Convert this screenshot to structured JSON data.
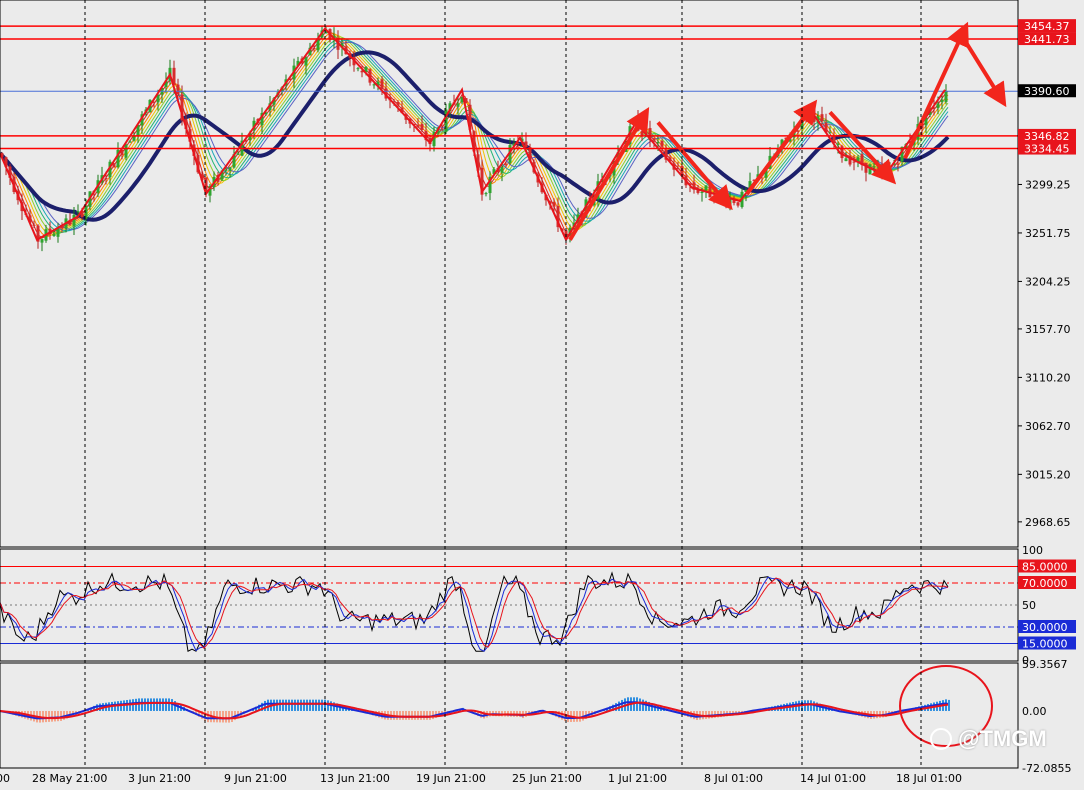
{
  "chart_data": [
    {
      "type": "candlestick",
      "panel": "price",
      "y_ticks": [
        "3299.25",
        "3251.75",
        "3204.25",
        "3157.70",
        "3110.20",
        "3062.70",
        "3015.20",
        "2968.65"
      ],
      "ylim": [
        2945,
        3480
      ],
      "levels": [
        {
          "label": "3454.37",
          "value": 3454.37,
          "color": "#ff0000"
        },
        {
          "label": "3441.73",
          "value": 3441.73,
          "color": "#ff0000"
        },
        {
          "label": "3390.60",
          "value": 3390.6,
          "color": "#4a6fd8"
        },
        {
          "label": "3346.82",
          "value": 3346.82,
          "color": "#ff0000"
        },
        {
          "label": "3334.45",
          "value": 3334.45,
          "color": "#ff0000"
        }
      ],
      "current_price_label": "3390.60",
      "x_ticks": [
        "00",
        "28 May 21:00",
        "3 Jun 21:00",
        "9 Jun 21:00",
        "13 Jun 21:00",
        "19 Jun 21:00",
        "25 Jun 21:00",
        "1 Jul 21:00",
        "8 Jul 01:00",
        "14 Jul 01:00",
        "18 Jul 01:00"
      ],
      "zigzag": [
        {
          "t": 0,
          "v": 3330
        },
        {
          "t": 37,
          "v": 3245
        },
        {
          "t": 78,
          "v": 3268
        },
        {
          "t": 170,
          "v": 3407
        },
        {
          "t": 206,
          "v": 3290
        },
        {
          "t": 325,
          "v": 3452
        },
        {
          "t": 430,
          "v": 3340
        },
        {
          "t": 462,
          "v": 3392
        },
        {
          "t": 482,
          "v": 3292
        },
        {
          "t": 520,
          "v": 3345
        },
        {
          "t": 566,
          "v": 3245
        },
        {
          "t": 636,
          "v": 3360
        },
        {
          "t": 692,
          "v": 3296
        },
        {
          "t": 740,
          "v": 3283
        },
        {
          "t": 810,
          "v": 3373
        },
        {
          "t": 840,
          "v": 3330
        },
        {
          "t": 885,
          "v": 3308
        },
        {
          "t": 945,
          "v": 3392
        }
      ],
      "arrows": [
        {
          "from": [
            570,
            3245
          ],
          "to": [
            643,
            3365
          ]
        },
        {
          "from": [
            658,
            3360
          ],
          "to": [
            725,
            3283
          ]
        },
        {
          "from": [
            747,
            3290
          ],
          "to": [
            810,
            3373
          ]
        },
        {
          "from": [
            830,
            3370
          ],
          "to": [
            888,
            3308
          ]
        },
        {
          "from": [
            905,
            3325
          ],
          "to": [
            963,
            3448
          ]
        },
        {
          "from": [
            965,
            3440
          ],
          "to": [
            1000,
            3385
          ]
        }
      ]
    },
    {
      "type": "line",
      "panel": "oscillator",
      "ylim": [
        0,
        100
      ],
      "y_ticks": [
        "100",
        "50",
        "0"
      ],
      "levels": [
        {
          "label": "85.0000",
          "value": 85,
          "color": "#ff0000"
        },
        {
          "label": "70.0000",
          "value": 70,
          "color": "#ff0000"
        },
        {
          "label": "30.0000",
          "value": 30,
          "color": "#1a2bd6"
        },
        {
          "label": "15.0000",
          "value": 15,
          "color": "#1a2bd6"
        }
      ]
    },
    {
      "type": "histogram",
      "panel": "macd",
      "ylim": [
        -72.0855,
        59.3567
      ],
      "y_ticks": [
        "59.3567",
        "0.00",
        "-72.0855"
      ]
    }
  ],
  "watermark": "@TMGM"
}
